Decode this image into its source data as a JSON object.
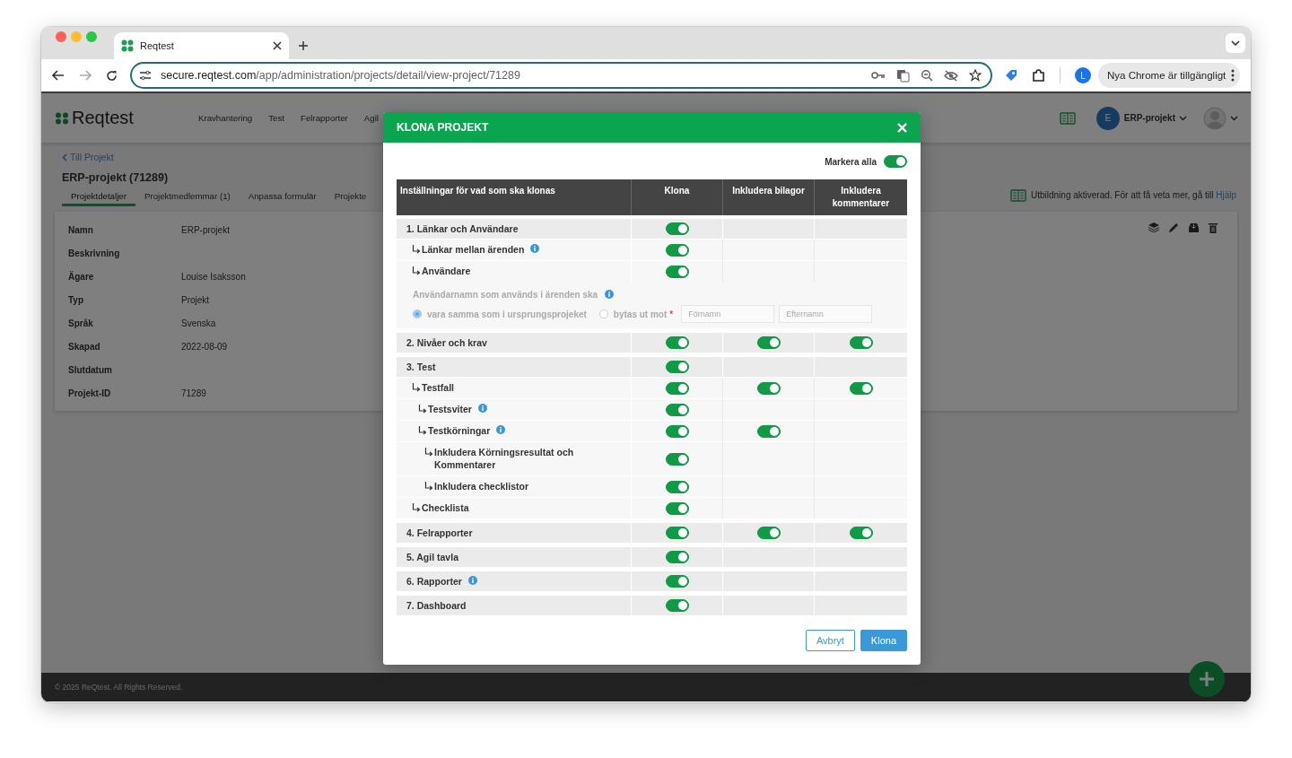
{
  "browser": {
    "tab_title": "Reqtest",
    "url_host": "secure.reqtest.com",
    "url_path": "/app/administration/projects/detail/view-project/71289",
    "profile_initial": "L",
    "update_button": "Nya Chrome är tillgängligt"
  },
  "app": {
    "logo": "Reqtest",
    "nav": [
      "Kravhantering",
      "Test",
      "Felrapporter",
      "Agil"
    ],
    "project_badge": "E",
    "project_menu": "ERP-projekt",
    "back_link": "Till Projekt",
    "project_title": "ERP-projekt (71289)",
    "tabs": [
      {
        "label": "Projektdetaljer",
        "selected": true
      },
      {
        "label": "Projektmedlemmar (1)",
        "selected": false
      },
      {
        "label": "Anpassa formulär",
        "selected": false
      },
      {
        "label": "Projekte",
        "selected": false
      }
    ],
    "training_notice": "Utbildning aktiverad. För att få veta mer, gå till",
    "help_link": "Hjälp",
    "details": [
      {
        "label": "Namn",
        "value": "ERP-projekt"
      },
      {
        "label": "Beskrivning"
      },
      {
        "label": "Ägare",
        "value": "Louise Isaksson"
      },
      {
        "label": "Typ",
        "value": "Projekt"
      },
      {
        "label": "Språk",
        "value": "Svenska"
      },
      {
        "label": "Skapad",
        "value": "2022-08-09"
      },
      {
        "label": "Slutdatum"
      },
      {
        "label": "Projekt-ID",
        "value": "71289"
      }
    ],
    "footer": "© 2025 ReQtest. All Rights Reserved."
  },
  "modal": {
    "title": "KLONA PROJEKT",
    "select_all": {
      "label": "Markera alla",
      "on": true
    },
    "columns": [
      "Inställningar för vad som ska klonas",
      "Klona",
      "Inkludera bilagor",
      "Inkludera kommentarer"
    ],
    "rows": [
      {
        "label": "1. Länkar och Användare",
        "clone": {
          "on": true
        },
        "children": [
          {
            "label": "Länkar mellan ärenden",
            "info": true,
            "clone": {
              "on": true
            }
          },
          {
            "label": "Användare",
            "clone": {
              "on": true
            },
            "user_mapping": {
              "disabled": true,
              "prompt": "Användarnamn som används i ärenden ska",
              "info": true,
              "options": [
                {
                  "label": "vara samma som i ursprungsprojeket",
                  "selected": true
                },
                {
                  "label": "bytas ut mot",
                  "selected": false,
                  "required_mark": "*"
                }
              ],
              "fields": [
                {
                  "placeholder": "Förnamn"
                },
                {
                  "placeholder": "Efternamn"
                }
              ]
            }
          }
        ]
      },
      {
        "label": "2. Nivåer och krav",
        "clone": {
          "on": true
        },
        "attachments": {
          "on": true
        },
        "comments": {
          "on": true
        }
      },
      {
        "label": "3. Test",
        "clone": {
          "on": true
        },
        "children": [
          {
            "label": "Testfall",
            "clone": {
              "on": true
            },
            "attachments": {
              "on": true
            },
            "comments": {
              "on": true
            },
            "children": [
              {
                "label": "Testsviter",
                "info": true,
                "clone": {
                  "on": true
                }
              },
              {
                "label": "Testkörningar",
                "info": true,
                "clone": {
                  "on": true
                },
                "attachments": {
                  "on": true
                },
                "children": [
                  {
                    "label": "Inkludera Körningsresultat och Kommentarer",
                    "clone": {
                      "on": true
                    }
                  },
                  {
                    "label": "Inkludera checklistor",
                    "clone": {
                      "on": true
                    }
                  }
                ]
              }
            ]
          },
          {
            "label": "Checklista",
            "clone": {
              "on": true
            }
          }
        ]
      },
      {
        "label": "4. Felrapporter",
        "clone": {
          "on": true
        },
        "attachments": {
          "on": true
        },
        "comments": {
          "on": true
        }
      },
      {
        "label": "5. Agil tavla",
        "clone": {
          "on": true
        }
      },
      {
        "label": "6. Rapporter",
        "info": true,
        "clone": {
          "on": true
        }
      },
      {
        "label": "7. Dashboard",
        "clone": {
          "on": true
        }
      }
    ],
    "buttons": [
      {
        "label": "Avbryt",
        "kind": "secondary"
      },
      {
        "label": "Klona",
        "kind": "primary"
      }
    ]
  }
}
